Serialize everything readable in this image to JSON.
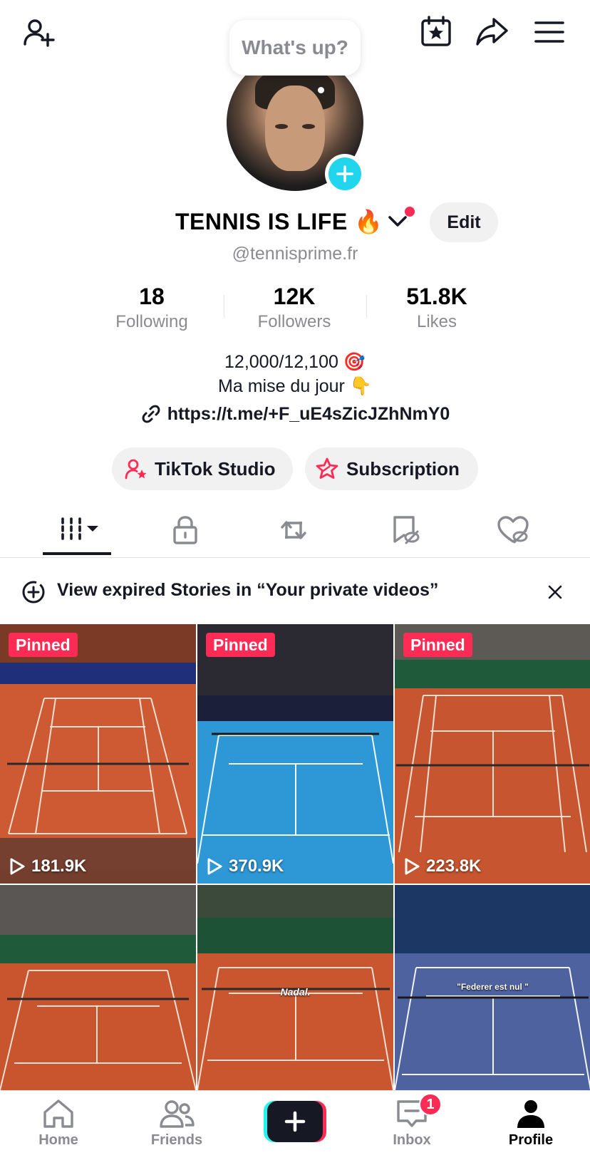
{
  "header": {
    "bubble_text": "What's up?"
  },
  "profile": {
    "display_name": "TENNIS IS LIFE 🔥",
    "handle": "@tennisprime.fr",
    "edit_label": "Edit"
  },
  "stats": [
    {
      "value": "18",
      "label": "Following"
    },
    {
      "value": "12K",
      "label": "Followers"
    },
    {
      "value": "51.8K",
      "label": "Likes"
    }
  ],
  "bio": {
    "line1": "12,000/12,100 🎯",
    "line2": "Ma mise du jour 👇",
    "link": "https://t.me/+F_uE4sZicJZhNmY0"
  },
  "actions": {
    "studio_label": "TikTok Studio",
    "subscription_label": "Subscription"
  },
  "banner": {
    "text": "View expired Stories in “Your private videos”"
  },
  "videos": [
    {
      "pinned": "Pinned",
      "views": "181.9K"
    },
    {
      "pinned": "Pinned",
      "views": "370.9K"
    },
    {
      "pinned": "Pinned",
      "views": "223.8K"
    },
    {
      "overlay": ""
    },
    {
      "overlay": "Nadal."
    },
    {
      "overlay": "\"Federer est nul \""
    }
  ],
  "nav": {
    "home": "Home",
    "friends": "Friends",
    "inbox": "Inbox",
    "inbox_badge": "1",
    "profile": "Profile"
  },
  "colors": {
    "accent": "#fe2c55",
    "cyan": "#20d5ec"
  }
}
